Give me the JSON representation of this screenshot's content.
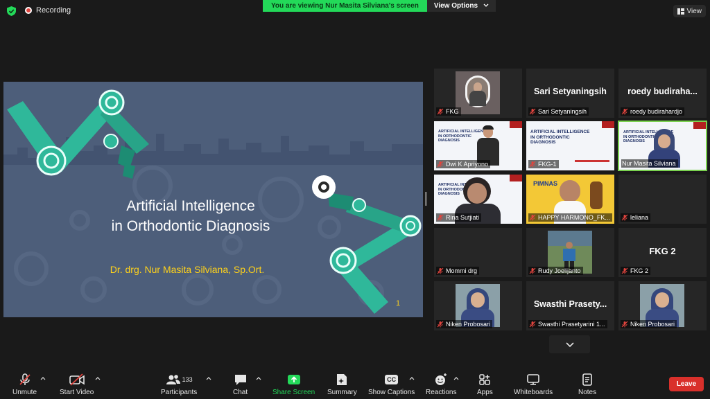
{
  "topbar": {
    "recording_label": "Recording",
    "banner_text": "You are viewing Nur Masita Silviana's screen",
    "view_options_label": "View Options",
    "view_label": "View"
  },
  "slide": {
    "title_line1": "Artificial Intelligence",
    "title_line2": "in Orthodontic Diagnosis",
    "author": "Dr. drg. Nur Masita Silviana, Sp.Ort.",
    "page_number": "1"
  },
  "gallery": {
    "tiles": [
      {
        "label": "FKG",
        "big_name": ""
      },
      {
        "label": "Sari Setyaningsih",
        "big_name": "Sari Setyaningsih"
      },
      {
        "label": "roedy budirahardjo",
        "big_name": "roedy  budiraha..."
      },
      {
        "label": "Dwi K Apriyono",
        "big_name": ""
      },
      {
        "label": "FKG-1",
        "big_name": ""
      },
      {
        "label": "Nur Masita Silviana",
        "big_name": ""
      },
      {
        "label": "Rina Sutjiati",
        "big_name": ""
      },
      {
        "label": "HAPPY HARMONO_FK...",
        "big_name": ""
      },
      {
        "label": "leliana",
        "big_name": ""
      },
      {
        "label": "Mommi drg",
        "big_name": ""
      },
      {
        "label": "Rudy Joelijanto",
        "big_name": ""
      },
      {
        "label": "FKG 2",
        "big_name": "FKG 2"
      },
      {
        "label": "Niken Probosari",
        "big_name": ""
      },
      {
        "label": "Swasthi Prasetyarini 1...",
        "big_name": "Swasthi  Prasety..."
      },
      {
        "label": "Niken Probosari",
        "big_name": ""
      }
    ],
    "mini_slide_title": "ARTIFICIAL INTELLIGENCE IN ORTHODONTIC DIAGNOSIS",
    "mini_slide_title_l1": "ARTIFICIAL INTELLIGENCE",
    "mini_slide_title_l2": "IN ORTHODONTIC",
    "mini_slide_title_l3": "DIAGNOSIS",
    "pimnas_text": "PIMNAS"
  },
  "toolbar": {
    "unmute": "Unmute",
    "start_video": "Start Video",
    "participants": "Participants",
    "participants_count": "133",
    "chat": "Chat",
    "share_screen": "Share Screen",
    "summary": "Summary",
    "show_captions": "Show Captions",
    "captions_icon_text": "CC",
    "reactions": "Reactions",
    "apps": "Apps",
    "whiteboards": "Whiteboards",
    "notes": "Notes",
    "leave": "Leave"
  },
  "colors": {
    "background": "#1a1a1a",
    "banner_green": "#23d959",
    "slide_bg": "#4d5e7a",
    "slide_accent": "#2fb89a",
    "author_yellow": "#ffd21a",
    "leave_red": "#d9302b",
    "active_border": "#7ad14f",
    "mic_off_red": "#e0443e"
  }
}
